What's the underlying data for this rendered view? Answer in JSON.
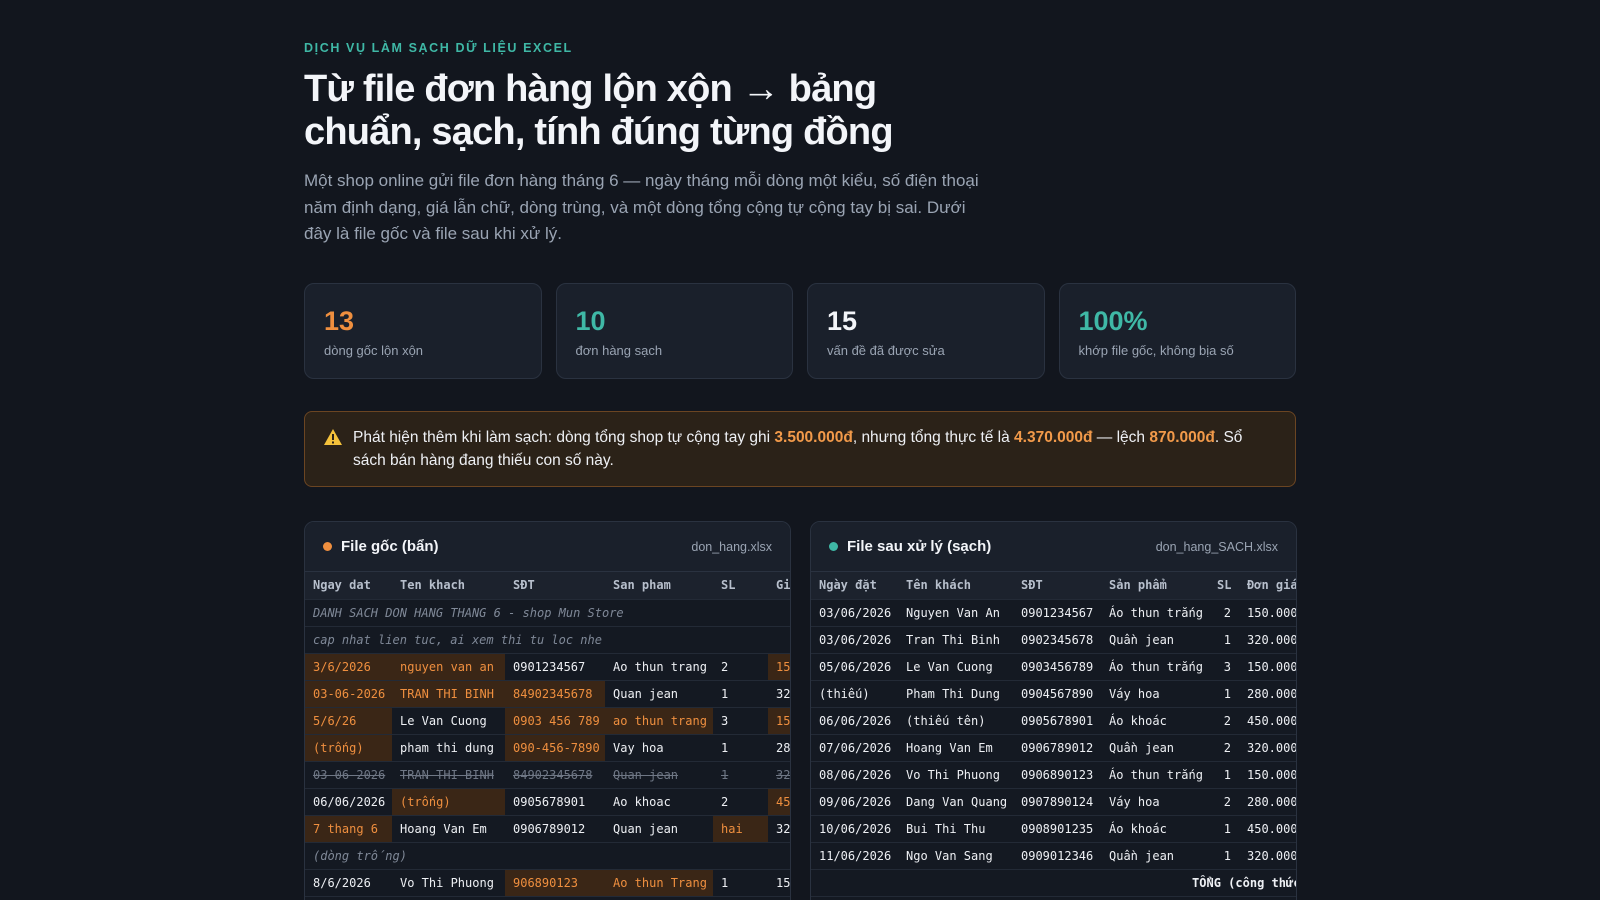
{
  "hero": {
    "eyebrow": "DỊCH VỤ LÀM SẠCH DỮ LIỆU EXCEL",
    "title": "Từ file đơn hàng lộn xộn → bảng chuẩn, sạch, tính đúng từng đồng",
    "lead": "Một shop online gửi file đơn hàng tháng 6 — ngày tháng mỗi dòng một kiểu, số điện thoại năm định dạng, giá lẫn chữ, dòng trùng, và một dòng tổng cộng tự cộng tay bị sai. Dưới đây là file gốc và file sau khi xử lý."
  },
  "stats": [
    {
      "value": "13",
      "label": "dòng gốc lộn xộn",
      "color": "#ef8f3f"
    },
    {
      "value": "10",
      "label": "đơn hàng sạch",
      "color": "#3fb8a6"
    },
    {
      "value": "15",
      "label": "vấn đề đã được sửa",
      "color": "#f3f5f9"
    },
    {
      "value": "100%",
      "label": "khớp file gốc, không bịa số",
      "color": "#3fb8a6"
    }
  ],
  "alert": {
    "icon": "warning-icon",
    "p1": "Phát hiện thêm khi làm sạch: dòng tổng shop tự cộng tay ghi ",
    "v1": "3.500.000đ",
    "p2": ", nhưng tổng thực tế là ",
    "v2": "4.370.000đ",
    "p3": " — lệch ",
    "v3": "870.000đ",
    "p4": ". Sổ sách bán hàng đang thiếu con số này."
  },
  "left_panel": {
    "title": "File gốc (bẩn)",
    "file": "don_hang.xlsx",
    "columns": [
      "Ngay dat",
      "Ten khach",
      "SĐT",
      "San pham",
      "SL",
      "Gi"
    ],
    "notes": [
      "DANH SACH DON HANG THANG 6 - shop Mun Store",
      "cap nhat lien tuc, ai xem thi tu loc nhe"
    ],
    "rows": [
      [
        "3/6/2026",
        "nguyen van an",
        "0901234567",
        "Ao thun trang",
        "2",
        "15"
      ],
      [
        "03-06-2026",
        "TRAN THI BINH",
        "84902345678",
        "Quan jean",
        "1",
        "32"
      ],
      [
        "5/6/26",
        "Le Van Cuong",
        "0903 456 789",
        "ao thun trang",
        "3",
        "15"
      ],
      [
        "(trống)",
        "pham thi dung",
        "090-456-7890",
        "Vay hoa",
        "1",
        "28"
      ],
      [
        "03-06-2026",
        "TRAN THI BINH",
        "84902345678",
        "Quan jean",
        "1",
        "32"
      ],
      [
        "06/06/2026",
        "(trống)",
        "0905678901",
        "Ao khoac",
        "2",
        "45"
      ],
      [
        "7 thang 6",
        "Hoang Van Em",
        "0906789012",
        "Quan jean",
        "hai",
        "32"
      ],
      [
        "8/6/2026",
        "Vo Thi Phuong",
        "906890123",
        "Ao thun Trang",
        "1",
        "15"
      ]
    ],
    "empty_row": "(dòng trống)"
  },
  "right_panel": {
    "title": "File sau xử lý (sạch)",
    "file": "don_hang_SACH.xlsx",
    "columns": [
      "Ngày đặt",
      "Tên khách",
      "SĐT",
      "Sản phẩm",
      "SL",
      "Đơn giá"
    ],
    "rows": [
      [
        "03/06/2026",
        "Nguyen Van An",
        "0901234567",
        "Áo thun trắng",
        "2",
        "150.000"
      ],
      [
        "03/06/2026",
        "Tran Thi Binh",
        "0902345678",
        "Quần jean",
        "1",
        "320.000"
      ],
      [
        "05/06/2026",
        "Le Van Cuong",
        "0903456789",
        "Áo thun trắng",
        "3",
        "150.000"
      ],
      [
        "(thiếu)",
        "Pham Thi Dung",
        "0904567890",
        "Váy hoa",
        "1",
        "280.000"
      ],
      [
        "06/06/2026",
        "(thiếu tên)",
        "0905678901",
        "Áo khoác",
        "2",
        "450.000"
      ],
      [
        "07/06/2026",
        "Hoang Van Em",
        "0906789012",
        "Quần jean",
        "2",
        "320.000"
      ],
      [
        "08/06/2026",
        "Vo Thi Phuong",
        "0906890123",
        "Áo thun trắng",
        "1",
        "150.000"
      ],
      [
        "09/06/2026",
        "Dang Van Quang",
        "0907890124",
        "Váy hoa",
        "2",
        "280.000"
      ],
      [
        "10/06/2026",
        "Bui Thi Thu",
        "0908901235",
        "Áo khoác",
        "1",
        "450.000"
      ],
      [
        "11/06/2026",
        "Ngo Van Sang",
        "0909012346",
        "Quần jean",
        "1",
        "320.000"
      ]
    ],
    "total_label": "TỔNG (công thức =SUM):"
  }
}
